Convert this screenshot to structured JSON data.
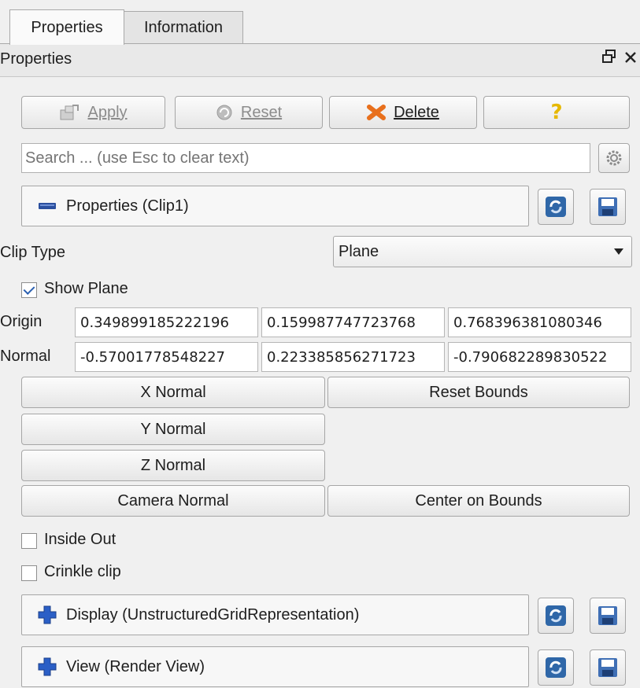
{
  "tabs": [
    {
      "label": "Properties",
      "active": true
    },
    {
      "label": "Information",
      "active": false
    }
  ],
  "dock": {
    "title": "Properties",
    "float_icon": "float-icon",
    "close_icon": "close-icon"
  },
  "toolbar": {
    "apply_label": "Apply",
    "reset_label": "Reset",
    "delete_label": "Delete",
    "help_label": "?"
  },
  "search": {
    "placeholder": "Search ... (use Esc to clear text)"
  },
  "sections": {
    "properties": "Properties (Clip1)",
    "display": "Display (UnstructuredGridRepresentation)",
    "view": "View (Render View)"
  },
  "clip_type": {
    "label": "Clip Type",
    "value": "Plane"
  },
  "show_plane": {
    "label": "Show Plane",
    "checked": true
  },
  "origin": {
    "label": "Origin",
    "values": [
      "0.349899185222196",
      "0.159987747723768",
      "0.768396381080346"
    ]
  },
  "normal": {
    "label": "Normal",
    "values": [
      "-0.57001778548227",
      "0.223385856271723",
      "-0.790682289830522"
    ]
  },
  "plane_buttons": {
    "x_normal": "X Normal",
    "reset_bounds": "Reset Bounds",
    "y_normal": "Y Normal",
    "z_normal": "Z Normal",
    "camera_normal": "Camera Normal",
    "center_on_bounds": "Center on Bounds"
  },
  "inside_out": {
    "label": "Inside Out",
    "checked": false
  },
  "crinkle_clip": {
    "label": "Crinkle clip",
    "checked": false
  },
  "colors": {
    "background": "#f0f0f0",
    "delete_icon": "#e8701d",
    "help_icon": "#e6b800",
    "minus_icon": "#2b4f9e",
    "plus_icon": "#2b5fc6",
    "check": "#2a5fb0"
  }
}
